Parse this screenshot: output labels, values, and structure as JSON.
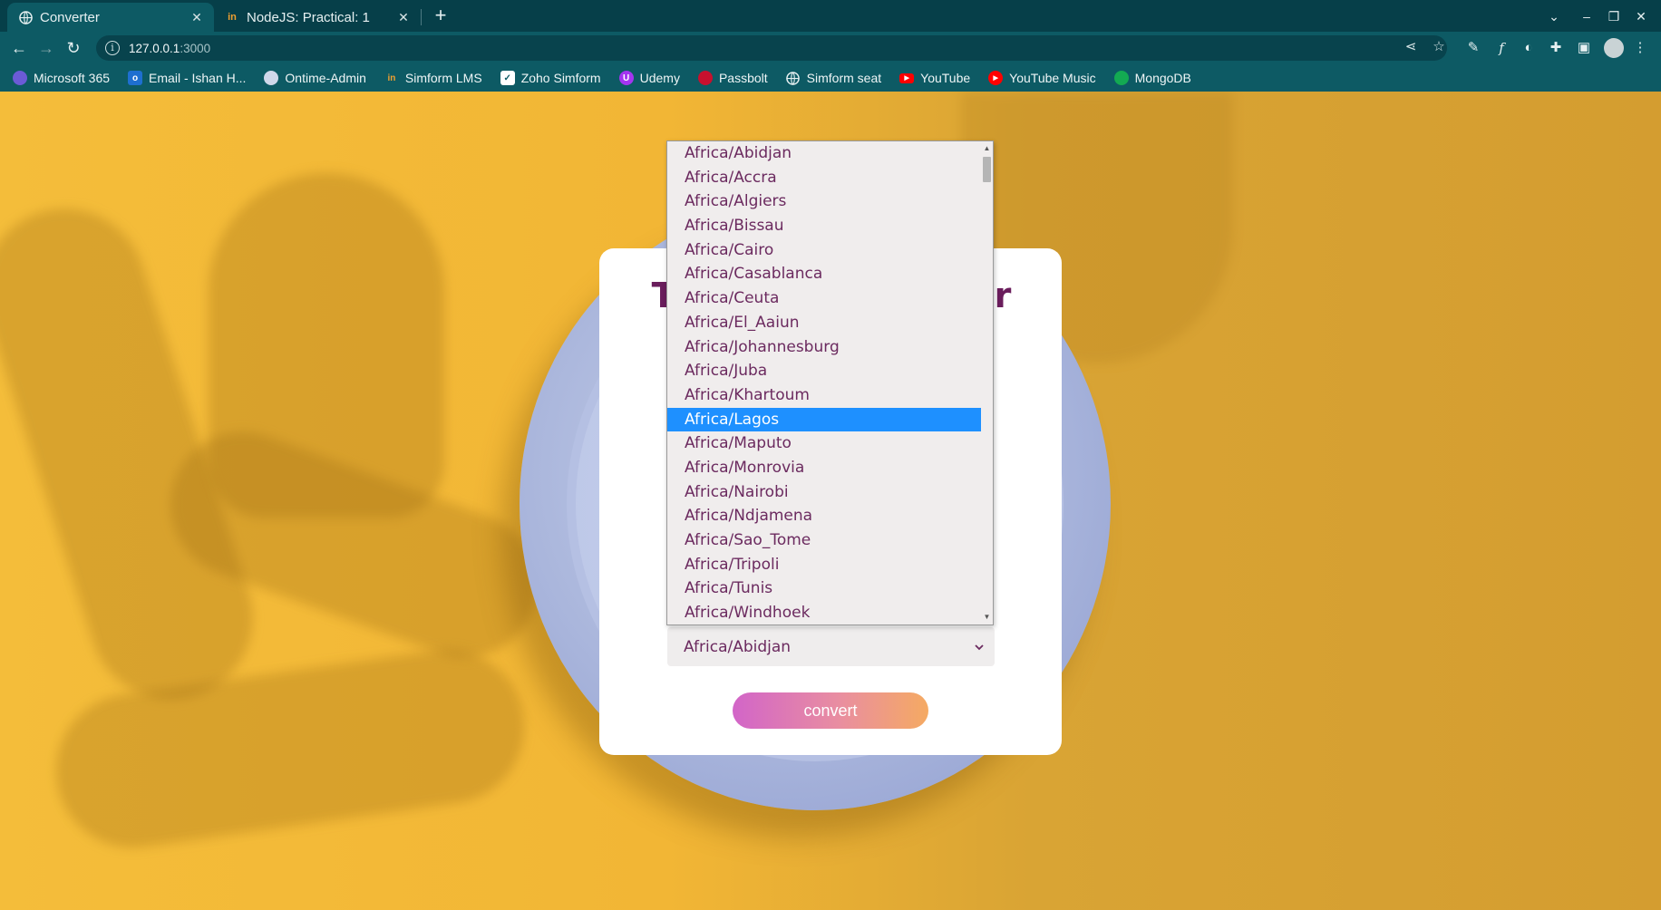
{
  "browser": {
    "tabs": [
      {
        "title": "Converter",
        "favicon": "globe-icon",
        "active": true
      },
      {
        "title": "NodeJS: Practical: 1",
        "favicon": "in",
        "active": false
      }
    ],
    "new_tab_icon": "+",
    "url_host": "127.0.0.1",
    "url_port": ":3000",
    "bookmarks": [
      {
        "label": "Microsoft 365",
        "icon": "microsoft-365-icon",
        "color": "#6b5bd6"
      },
      {
        "label": "Email - Ishan H...",
        "icon": "outlook-icon",
        "color": "#1e6fd0"
      },
      {
        "label": "Ontime-Admin",
        "icon": "ontime-icon",
        "color": "#cfd8ea"
      },
      {
        "label": "Simform LMS",
        "icon": "simform-lms-icon",
        "color": "#f0a030"
      },
      {
        "label": "Zoho Simform",
        "icon": "zoho-icon",
        "color": "#ffffff"
      },
      {
        "label": "Udemy",
        "icon": "udemy-icon",
        "color": "#a435f0"
      },
      {
        "label": "Passbolt",
        "icon": "passbolt-icon",
        "color": "#c8102e"
      },
      {
        "label": "Simform seat",
        "icon": "globe-icon",
        "color": "#e6f0f1"
      },
      {
        "label": "YouTube",
        "icon": "youtube-icon",
        "color": "#ff0000"
      },
      {
        "label": "YouTube Music",
        "icon": "youtube-music-icon",
        "color": "#ff0000"
      },
      {
        "label": "MongoDB",
        "icon": "mongodb-icon",
        "color": "#13aa52"
      }
    ]
  },
  "page": {
    "title_left": "T",
    "title_right": "r",
    "select_value": "Africa/Abidjan",
    "convert_label": "convert",
    "dropdown_options": [
      "Africa/Abidjan",
      "Africa/Accra",
      "Africa/Algiers",
      "Africa/Bissau",
      "Africa/Cairo",
      "Africa/Casablanca",
      "Africa/Ceuta",
      "Africa/El_Aaiun",
      "Africa/Johannesburg",
      "Africa/Juba",
      "Africa/Khartoum",
      "Africa/Lagos",
      "Africa/Maputo",
      "Africa/Monrovia",
      "Africa/Nairobi",
      "Africa/Ndjamena",
      "Africa/Sao_Tome",
      "Africa/Tripoli",
      "Africa/Tunis",
      "Africa/Windhoek"
    ],
    "highlighted_option": "Africa/Lagos"
  },
  "colors": {
    "accent_highlight": "#1e90ff",
    "title_color": "#6a1d5c",
    "option_text": "#6b2a5f"
  }
}
